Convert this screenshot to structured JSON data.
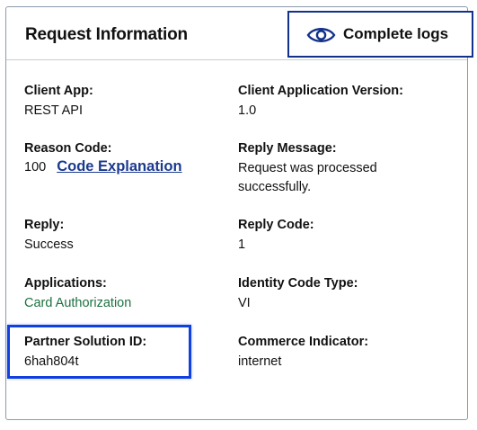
{
  "header": {
    "title": "Request Information",
    "logs_button_label": "Complete logs"
  },
  "fields": {
    "client_app": {
      "label": "Client App:",
      "value": "REST API"
    },
    "client_app_version": {
      "label": "Client Application Version:",
      "value": "1.0"
    },
    "reason_code": {
      "label": "Reason Code:",
      "value": "100",
      "link_label": "Code Explanation"
    },
    "reply_message": {
      "label": "Reply Message:",
      "value": "Request was processed successfully."
    },
    "reply": {
      "label": "Reply:",
      "value": "Success"
    },
    "reply_code": {
      "label": "Reply Code:",
      "value": "1"
    },
    "applications": {
      "label": "Applications:",
      "value": "Card Authorization"
    },
    "identity_code_type": {
      "label": "Identity Code Type:",
      "value": "VI"
    },
    "partner_solution_id": {
      "label": "Partner Solution ID:",
      "value": "6hah804t"
    },
    "commerce_indicator": {
      "label": "Commerce Indicator:",
      "value": "internet"
    }
  },
  "icons": {
    "logs_button_icon": "eye-icon"
  },
  "colors": {
    "link": "#1b3a8f",
    "button_border": "#12318a",
    "application_value": "#1c7140",
    "highlight": "#1140e0"
  }
}
